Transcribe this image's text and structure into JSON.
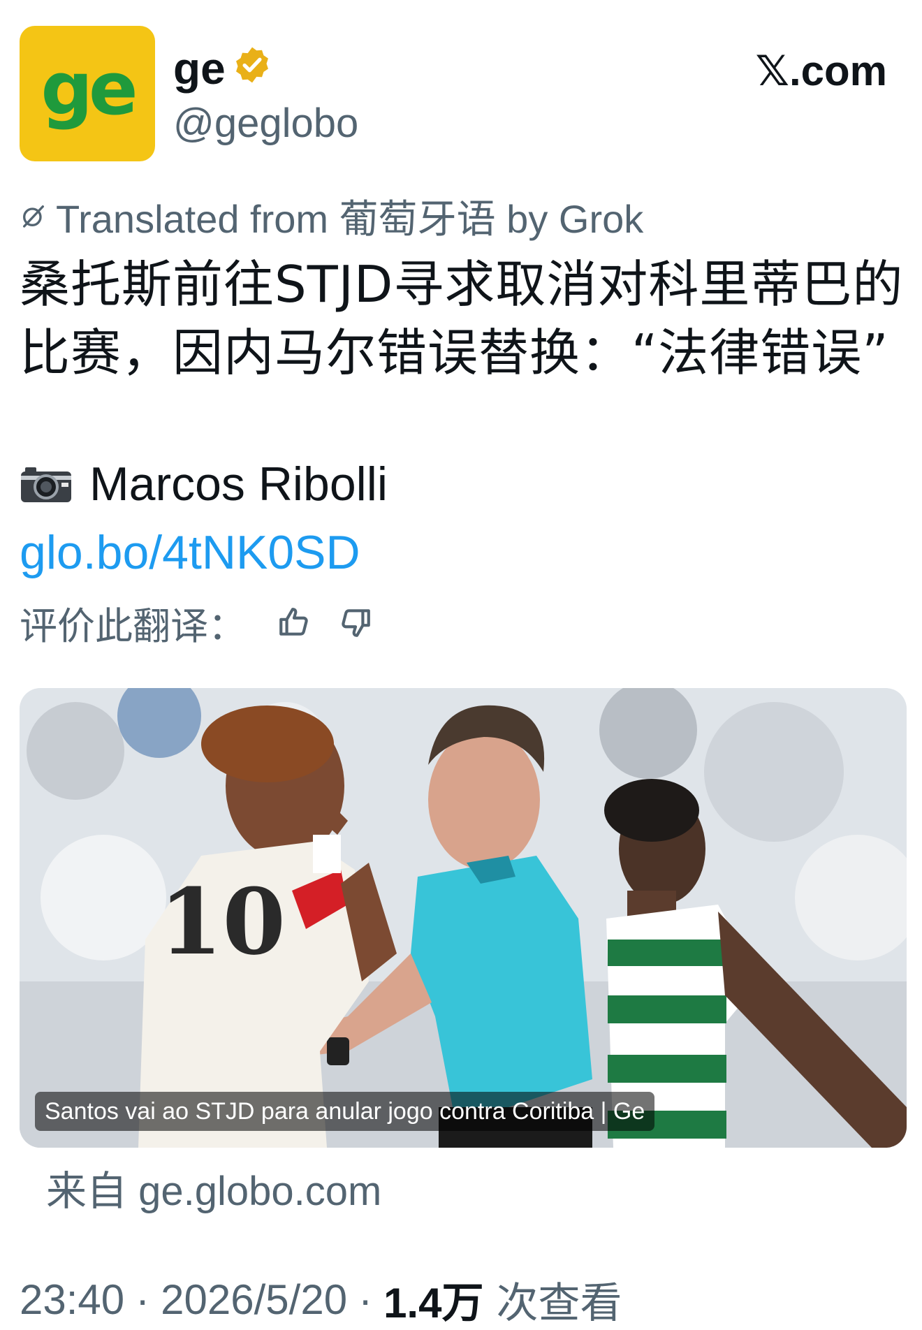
{
  "account": {
    "avatar_text": "ge",
    "display_name": "ge",
    "handle": "@geglobo",
    "verified_icon": "verified-badge-gold"
  },
  "source_logo": "𝕏.com",
  "translation": {
    "label": "Translated from 葡萄牙语 by Grok",
    "icon": "translate-icon"
  },
  "tweet": {
    "text_line1": "桑托斯前往STJD寻求取消对科里蒂巴的",
    "text_line2": "比赛，因内马尔错误替换：“法律错误”",
    "credit_icon": "camera-icon",
    "credit": "Marcos Ribolli",
    "link": "glo.bo/4tNK0SD"
  },
  "rate_translation": {
    "label": "评价此翻译：",
    "up_icon": "thumbs-up-icon",
    "down_icon": "thumbs-down-icon"
  },
  "card": {
    "caption": "Santos vai ao STJD para anular jogo contra Coritiba | Ge",
    "source": "来自 ge.globo.com"
  },
  "meta": {
    "time": "23:40",
    "date": "2026/5/20",
    "views": "1.4万",
    "views_label": "次查看"
  },
  "colors": {
    "avatar_bg": "#f4c515",
    "avatar_text": "#1f9a3c",
    "link": "#1d9bf0",
    "secondary_text": "#536471",
    "verified": "#e9b018"
  }
}
